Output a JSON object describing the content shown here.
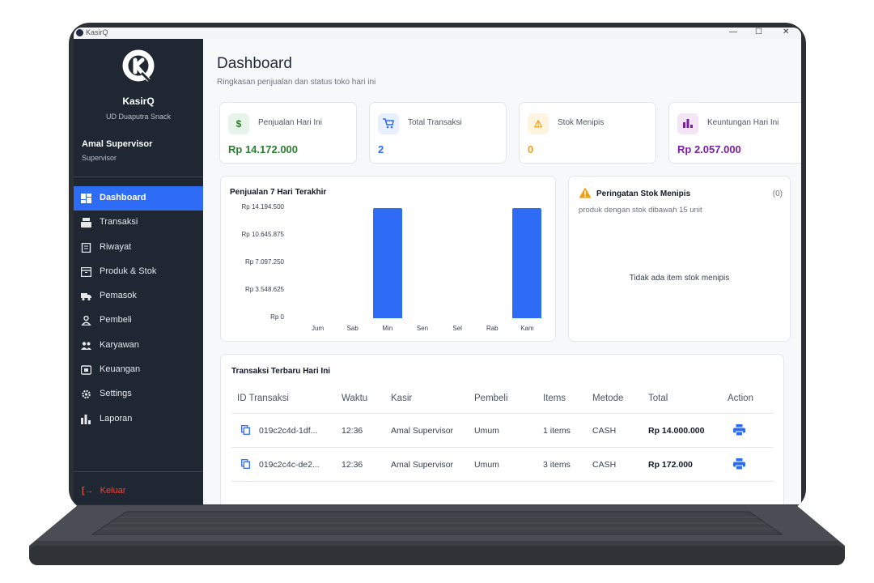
{
  "window": {
    "title": "KasirQ",
    "controls": {
      "minimize": "—",
      "maximize": "☐",
      "close": "✕"
    }
  },
  "sidebar": {
    "brand_name": "KasirQ",
    "store_name": "UD Duaputra Snack",
    "user_name": "Amal Supervisor",
    "user_role": "Supervisor",
    "items": [
      {
        "label": "Dashboard",
        "icon": "dashboard-icon",
        "active": true
      },
      {
        "label": "Transaksi",
        "icon": "cash-register-icon"
      },
      {
        "label": "Riwayat",
        "icon": "receipt-icon"
      },
      {
        "label": "Produk & Stok",
        "icon": "archive-box-icon"
      },
      {
        "label": "Pemasok",
        "icon": "truck-icon"
      },
      {
        "label": "Pembeli",
        "icon": "person-icon"
      },
      {
        "label": "Karyawan",
        "icon": "people-icon"
      },
      {
        "label": "Keuangan",
        "icon": "wallet-icon"
      },
      {
        "label": "Settings",
        "icon": "gear-icon"
      },
      {
        "label": "Laporan",
        "icon": "bar-chart-icon"
      }
    ],
    "logout_label": "Keluar"
  },
  "header": {
    "title": "Dashboard",
    "subtitle": "Ringkasan penjualan dan status toko hari ini"
  },
  "stats": [
    {
      "label": "Penjualan Hari Ini",
      "value": "Rp 14.172.000",
      "icon": "dollar-icon",
      "color": "#2e7d32",
      "bg": "#e6f4ea",
      "glyph": "$"
    },
    {
      "label": "Total Transaksi",
      "value": "2",
      "icon": "cart-icon",
      "color": "#2f6cf5",
      "bg": "#e8efff",
      "glyph": "🛒"
    },
    {
      "label": "Stok Menipis",
      "value": "0",
      "icon": "warning-icon",
      "color": "#f59e0b",
      "bg": "#fff4e0",
      "glyph": "⚠"
    },
    {
      "label": "Keuntungan Hari Ini",
      "value": "Rp 2.057.000",
      "icon": "bar-chart-icon",
      "color": "#7b1fa2",
      "bg": "#f3e5f5",
      "glyph": "▮"
    }
  ],
  "chart_data": {
    "type": "bar",
    "title": "Penjualan 7 Hari Terakhir",
    "categories": [
      "Jum",
      "Sab",
      "Min",
      "Sen",
      "Sel",
      "Rab",
      "Kam"
    ],
    "values": [
      0,
      0,
      14194500,
      0,
      0,
      0,
      14172000
    ],
    "ylim": [
      0,
      14194500
    ],
    "yticks": [
      "Rp 14.194.500",
      "Rp 10.645.875",
      "Rp 7.097.250",
      "Rp 3.548.625",
      "Rp 0"
    ],
    "color": "#2f6cf5",
    "grid": false
  },
  "stock_warning": {
    "title": "Peringatan Stok Menipis",
    "count": "(0)",
    "subtitle": "produk dengan stok dibawah 15 unit",
    "empty_text": "Tidak ada item stok menipis"
  },
  "transactions": {
    "title": "Transaksi Terbaru Hari Ini",
    "columns": [
      "ID Transaksi",
      "Waktu",
      "Kasir",
      "Pembeli",
      "Items",
      "Metode",
      "Total",
      "Action"
    ],
    "rows": [
      {
        "id": "019c2c4d-1df...",
        "time": "12:36",
        "cashier": "Amal Supervisor",
        "buyer": "Umum",
        "items": "1 items",
        "method": "CASH",
        "total": "Rp 14.000.000"
      },
      {
        "id": "019c2c4c-de2...",
        "time": "12:36",
        "cashier": "Amal Supervisor",
        "buyer": "Umum",
        "items": "3 items",
        "method": "CASH",
        "total": "Rp 172.000"
      }
    ]
  }
}
